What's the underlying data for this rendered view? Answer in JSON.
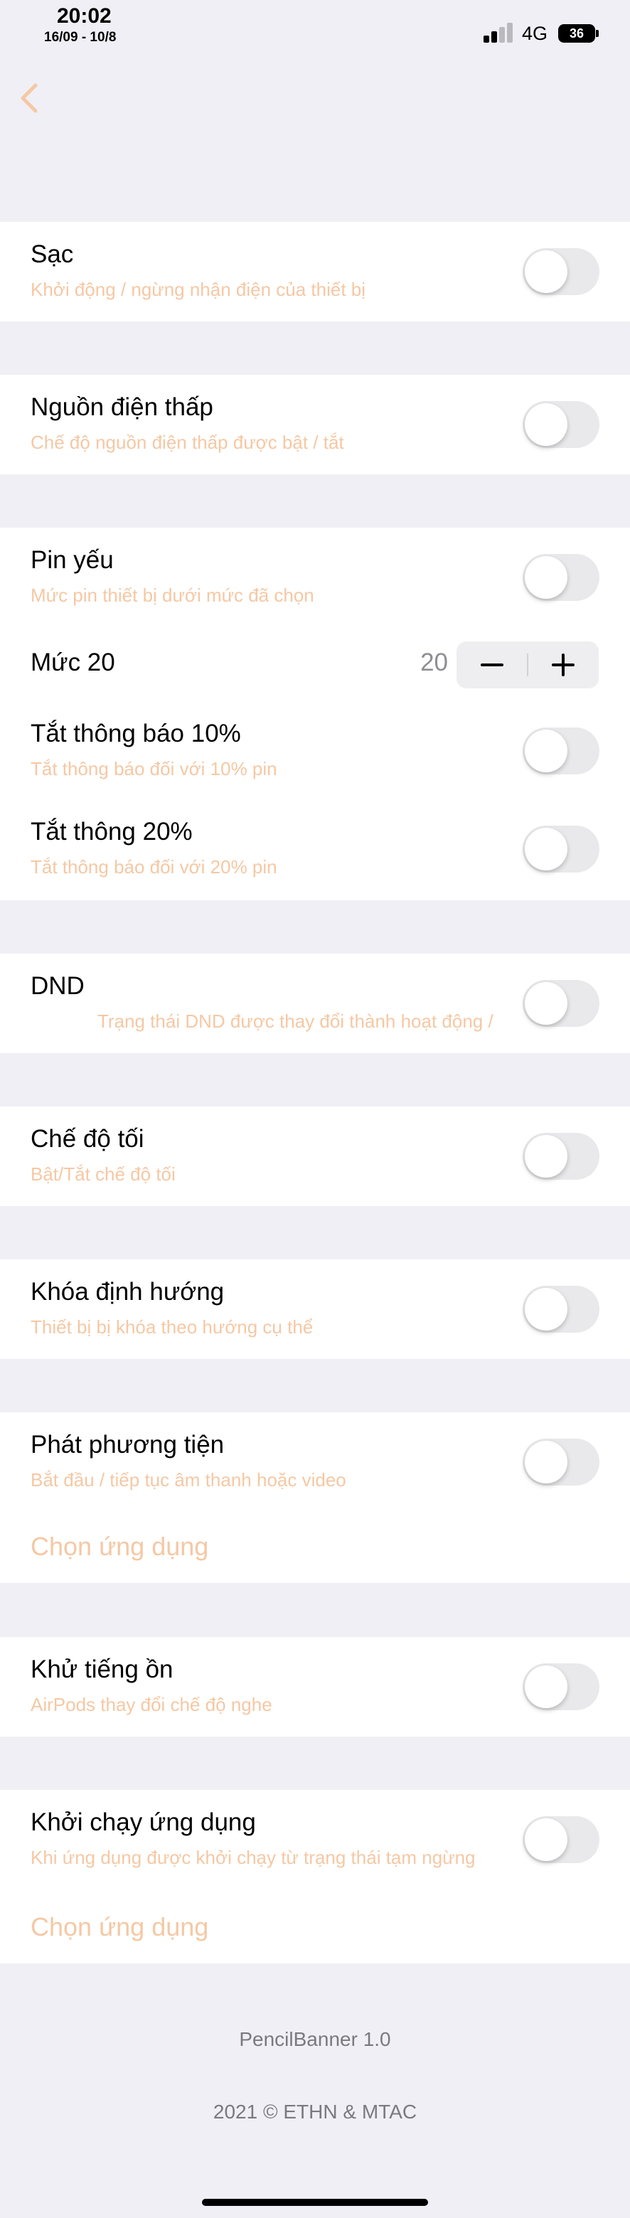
{
  "status_bar": {
    "time": "20:02",
    "date": "16/09 - 10/8",
    "network": "4G",
    "battery": "36"
  },
  "nav": {
    "back_icon": "chevron-left-icon"
  },
  "sections": {
    "charging": {
      "title": "Sạc",
      "subtitle": "Khởi động / ngừng nhận điện của thiết bị",
      "on": false
    },
    "low_power": {
      "title": "Nguồn điện thấp",
      "subtitle": "Chế độ nguồn điện thấp được bật / tắt",
      "on": false
    },
    "low_battery": {
      "title": "Pin yếu",
      "subtitle": "Mức pin thiết bị dưới mức đã chọn",
      "on": false,
      "level_label": "Mức 20",
      "level_value": "20",
      "mute_10_title": "Tắt thông báo 10%",
      "mute_10_subtitle": "Tắt thông báo đối với 10% pin",
      "mute_20_title": "Tắt thông 20%",
      "mute_20_subtitle": "Tắt thông báo đối với 20% pin"
    },
    "dnd": {
      "title": "DND",
      "subtitle": "Trạng thái DND được thay đổi thành hoạt động /",
      "on": false
    },
    "dark_mode": {
      "title": "Chế độ tối",
      "subtitle": "Bật/Tắt chế độ tối",
      "on": false
    },
    "orientation_lock": {
      "title": "Khóa định hướng",
      "subtitle": "Thiết bị bị khóa theo hướng cụ thể",
      "on": false
    },
    "media_play": {
      "title": "Phát phương tiện",
      "subtitle": "Bắt đầu / tiếp tục âm thanh hoặc video",
      "on": false,
      "choose_app": "Chọn ứng dụng"
    },
    "noise_cancel": {
      "title": "Khử tiếng ồn",
      "subtitle": "AirPods thay đổi chế độ nghe",
      "on": false
    },
    "app_launch": {
      "title": "Khởi chạy ứng dụng",
      "subtitle": "Khi ứng dụng được khởi chạy từ trạng thái tạm ngừng",
      "on": false,
      "choose_app": "Chọn ứng dụng"
    }
  },
  "footer": {
    "version": "PencilBanner 1.0",
    "copyright": "2021 © ETHN & MTAC"
  },
  "colors": {
    "background": "#f0eff5",
    "accent": "#f5c8a4",
    "toggle_off": "#e9e9eb"
  }
}
